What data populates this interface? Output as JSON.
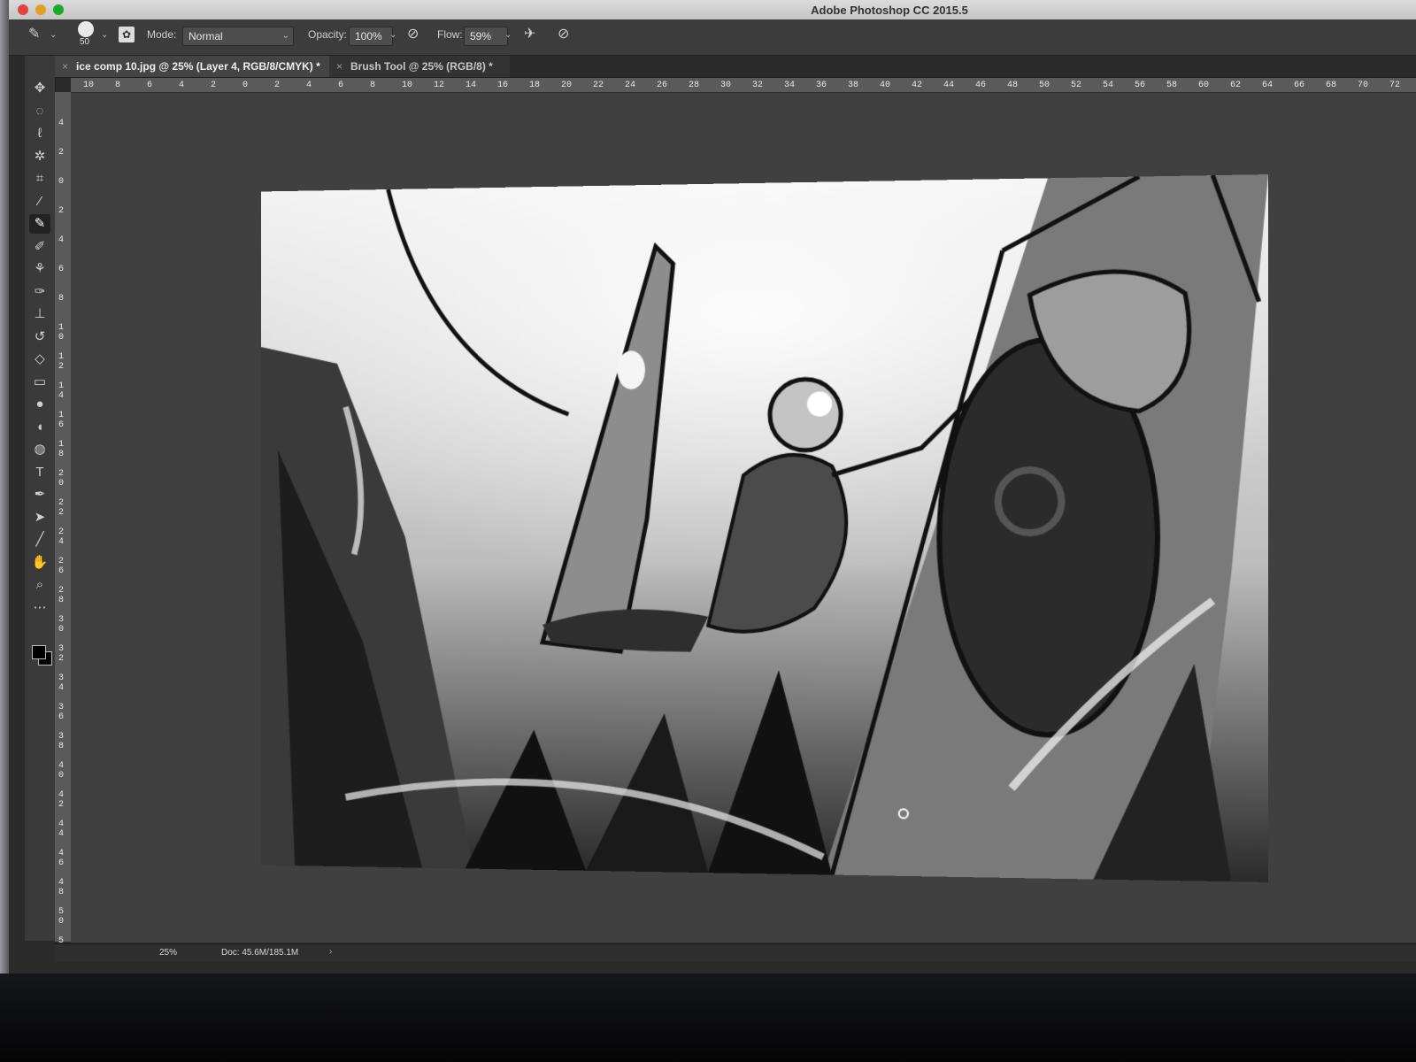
{
  "app": {
    "title": "Adobe Photoshop CC 2015.5"
  },
  "options_bar": {
    "brush_size": "50",
    "mode_label": "Mode:",
    "mode_value": "Normal",
    "opacity_label": "Opacity:",
    "opacity_value": "100%",
    "flow_label": "Flow:",
    "flow_value": "59%"
  },
  "tabs": [
    {
      "label": "ice comp 10.jpg @ 25% (Layer 4, RGB/8/CMYK) *",
      "active": true
    },
    {
      "label": "Brush Tool @ 25% (RGB/8) *",
      "active": false
    }
  ],
  "ruler_h": [
    "10",
    "8",
    "6",
    "4",
    "2",
    "0",
    "2",
    "4",
    "6",
    "8",
    "10",
    "12",
    "14",
    "16",
    "18",
    "20",
    "22",
    "24",
    "26",
    "28",
    "30",
    "32",
    "34",
    "36",
    "38",
    "40",
    "42",
    "44",
    "46",
    "48",
    "50",
    "52",
    "54",
    "56",
    "58",
    "60",
    "62",
    "64",
    "66",
    "68",
    "70",
    "72"
  ],
  "ruler_v": [
    "4",
    "2",
    "0",
    "2",
    "4",
    "6",
    "8",
    "1 0",
    "1 2",
    "1 4",
    "1 6",
    "1 8",
    "2 0",
    "2 2",
    "2 4",
    "2 6",
    "2 8",
    "3 0",
    "3 2",
    "3 4",
    "3 6",
    "3 8",
    "4 0",
    "4 2",
    "4 4",
    "4 6",
    "4 8",
    "5 0",
    "5"
  ],
  "status": {
    "zoom": "25%",
    "doc": "Doc: 45.6M/185.1M",
    "arrow": "›"
  },
  "tools": [
    {
      "name": "move-tool-icon",
      "glyph": "✥"
    },
    {
      "name": "marquee-tool-icon",
      "glyph": "◌"
    },
    {
      "name": "lasso-tool-icon",
      "glyph": "ℓ"
    },
    {
      "name": "magic-wand-tool-icon",
      "glyph": "✲"
    },
    {
      "name": "crop-tool-icon",
      "glyph": "⌗"
    },
    {
      "name": "eyedropper-tool-icon",
      "glyph": "⁄"
    },
    {
      "name": "brush-tool-icon",
      "glyph": "✎"
    },
    {
      "name": "pencil-tool-icon",
      "glyph": "✐"
    },
    {
      "name": "clone-stamp-tool-icon",
      "glyph": "⚘"
    },
    {
      "name": "mixer-brush-tool-icon",
      "glyph": "✑"
    },
    {
      "name": "stamp-tool-icon",
      "glyph": "⊥"
    },
    {
      "name": "history-brush-tool-icon",
      "glyph": "↺"
    },
    {
      "name": "eraser-tool-icon",
      "glyph": "◇"
    },
    {
      "name": "gradient-tool-icon",
      "glyph": "▭"
    },
    {
      "name": "blur-tool-icon",
      "glyph": "●"
    },
    {
      "name": "dodge-tool-icon",
      "glyph": "◖"
    },
    {
      "name": "smudge-tool-icon",
      "glyph": "◍"
    },
    {
      "name": "type-tool-icon",
      "glyph": "T"
    },
    {
      "name": "pen-tool-icon",
      "glyph": "✒"
    },
    {
      "name": "path-selection-tool-icon",
      "glyph": "➤"
    },
    {
      "name": "line-tool-icon",
      "glyph": "╱"
    },
    {
      "name": "hand-tool-icon",
      "glyph": "✋"
    },
    {
      "name": "zoom-tool-icon",
      "glyph": "⌕"
    },
    {
      "name": "more-tools-icon",
      "glyph": "⋯"
    }
  ],
  "colors": {
    "foreground": "#000000",
    "background": "#000000"
  }
}
